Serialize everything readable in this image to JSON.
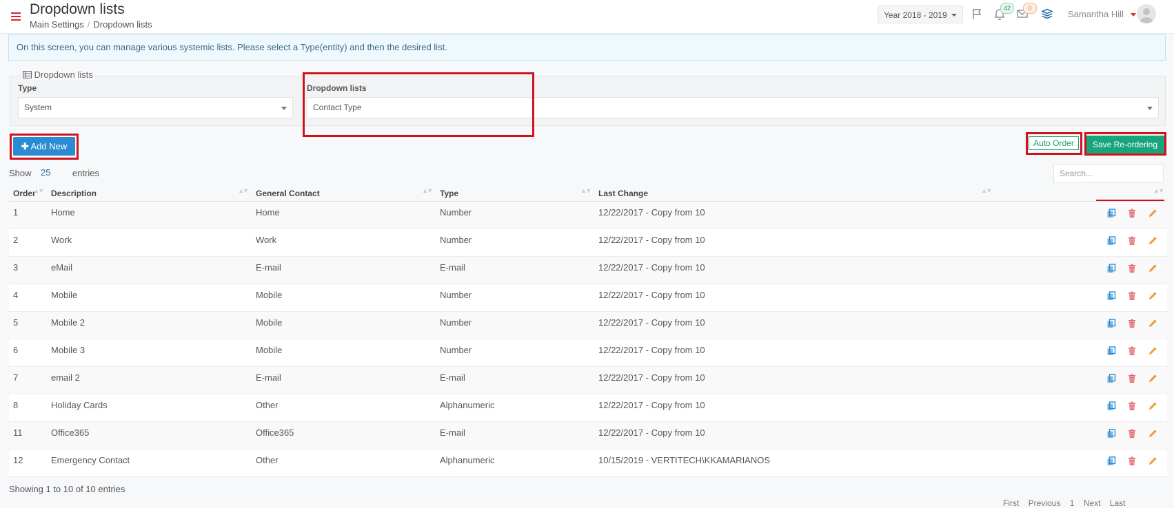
{
  "header": {
    "title": "Dropdown lists",
    "breadcrumb": [
      "Main Settings",
      "Dropdown lists"
    ],
    "year_select": "Year 2018 - 2019",
    "notifications_count": "42",
    "mail_count": "0",
    "user_name": "Samantha Hill"
  },
  "info_message": "On this screen, you can manage various systemic lists. Please select a Type(entity) and then the desired list.",
  "filter_panel": {
    "legend": "Dropdown lists",
    "type_label": "Type",
    "type_value": "System",
    "list_label": "Dropdown lists",
    "list_value": "Contact Type"
  },
  "toolbar": {
    "add_new_label": "Add New",
    "auto_order_label": "Auto Order",
    "save_reorder_label": "Save Re-ordering"
  },
  "table_controls": {
    "show_label": "Show",
    "page_size": "25",
    "entries_label": "entries",
    "search_placeholder": "Search..."
  },
  "table": {
    "columns": [
      "Order",
      "Description",
      "General Contact",
      "Type",
      "Last Change"
    ],
    "rows": [
      {
        "order": "1",
        "description": "Home",
        "general_contact": "Home",
        "type": "Number",
        "last_change": "12/22/2017 - Copy from 10"
      },
      {
        "order": "2",
        "description": "Work",
        "general_contact": "Work",
        "type": "Number",
        "last_change": "12/22/2017 - Copy from 10"
      },
      {
        "order": "3",
        "description": "eMail",
        "general_contact": "E-mail",
        "type": "E-mail",
        "last_change": "12/22/2017 - Copy from 10"
      },
      {
        "order": "4",
        "description": "Mobile",
        "general_contact": "Mobile",
        "type": "Number",
        "last_change": "12/22/2017 - Copy from 10"
      },
      {
        "order": "5",
        "description": "Mobile 2",
        "general_contact": "Mobile",
        "type": "Number",
        "last_change": "12/22/2017 - Copy from 10"
      },
      {
        "order": "6",
        "description": "Mobile 3",
        "general_contact": "Mobile",
        "type": "Number",
        "last_change": "12/22/2017 - Copy from 10"
      },
      {
        "order": "7",
        "description": "email 2",
        "general_contact": "E-mail",
        "type": "E-mail",
        "last_change": "12/22/2017 - Copy from 10"
      },
      {
        "order": "8",
        "description": "Holiday Cards",
        "general_contact": "Other",
        "type": "Alphanumeric",
        "last_change": "12/22/2017 - Copy from 10"
      },
      {
        "order": "11",
        "description": "Office365",
        "general_contact": "Office365",
        "type": "E-mail",
        "last_change": "12/22/2017 - Copy from 10"
      },
      {
        "order": "12",
        "description": "Emergency Contact",
        "general_contact": "Other",
        "type": "Alphanumeric",
        "last_change": "10/15/2019 - VERTITECH\\KKAMARIANOS"
      }
    ]
  },
  "footer": {
    "showing_text": "Showing 1 to 10 of 10 entries",
    "pagination": [
      "First",
      "Previous",
      "1",
      "Next",
      "Last"
    ]
  },
  "colors": {
    "accent_red": "#d9262b",
    "primary_blue": "#2b8bd2",
    "success_green": "#17a57c",
    "annotation_red": "#d0121b"
  },
  "icons": [
    "hamburger-menu-icon",
    "flag-icon",
    "bell-icon",
    "mail-icon",
    "layers-icon",
    "table-icon",
    "plus-icon",
    "copy-icon",
    "trash-icon",
    "pencil-icon"
  ]
}
